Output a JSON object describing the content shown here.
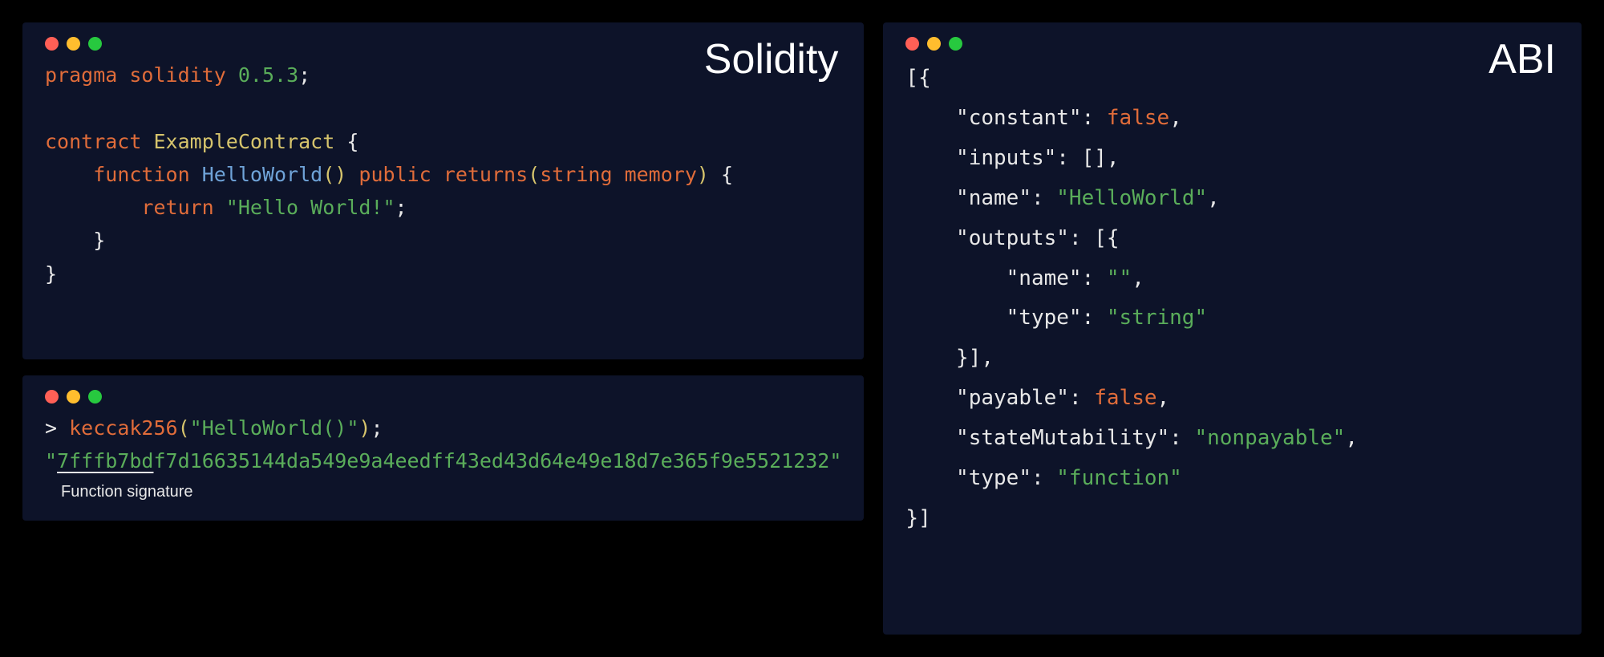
{
  "windows": {
    "solidity": {
      "title": "Solidity"
    },
    "abi": {
      "title": "ABI"
    }
  },
  "solidity": {
    "pragma_kw": "pragma",
    "solidity_kw": "solidity",
    "version": "0.5.3",
    "contract_kw": "contract",
    "contract_name": "ExampleContract",
    "function_kw": "function",
    "func_name": "HelloWorld",
    "public_kw": "public",
    "returns_kw": "returns",
    "ret_type1": "string",
    "ret_type2": "memory",
    "return_kw": "return",
    "ret_value": "\"Hello World!\""
  },
  "keccak": {
    "prompt": ">",
    "func": "keccak256",
    "arg": "\"HelloWorld()\"",
    "hash_prefix": "7fffb7bd",
    "hash_rest": "f7d16635144da549e9a4eedff43ed43d64e49e18d7e365f9e5521232",
    "sig_label": "Function signature"
  },
  "abi": {
    "k_constant": "\"constant\"",
    "v_constant": "false",
    "k_inputs": "\"inputs\"",
    "v_inputs": "[]",
    "k_name": "\"name\"",
    "v_name": "\"HelloWorld\"",
    "k_outputs": "\"outputs\"",
    "out_k_name": "\"name\"",
    "out_v_name": "\"\"",
    "out_k_type": "\"type\"",
    "out_v_type": "\"string\"",
    "k_payable": "\"payable\"",
    "v_payable": "false",
    "k_stateMutability": "\"stateMutability\"",
    "v_stateMutability": "\"nonpayable\"",
    "k_type": "\"type\"",
    "v_type": "\"function\""
  }
}
